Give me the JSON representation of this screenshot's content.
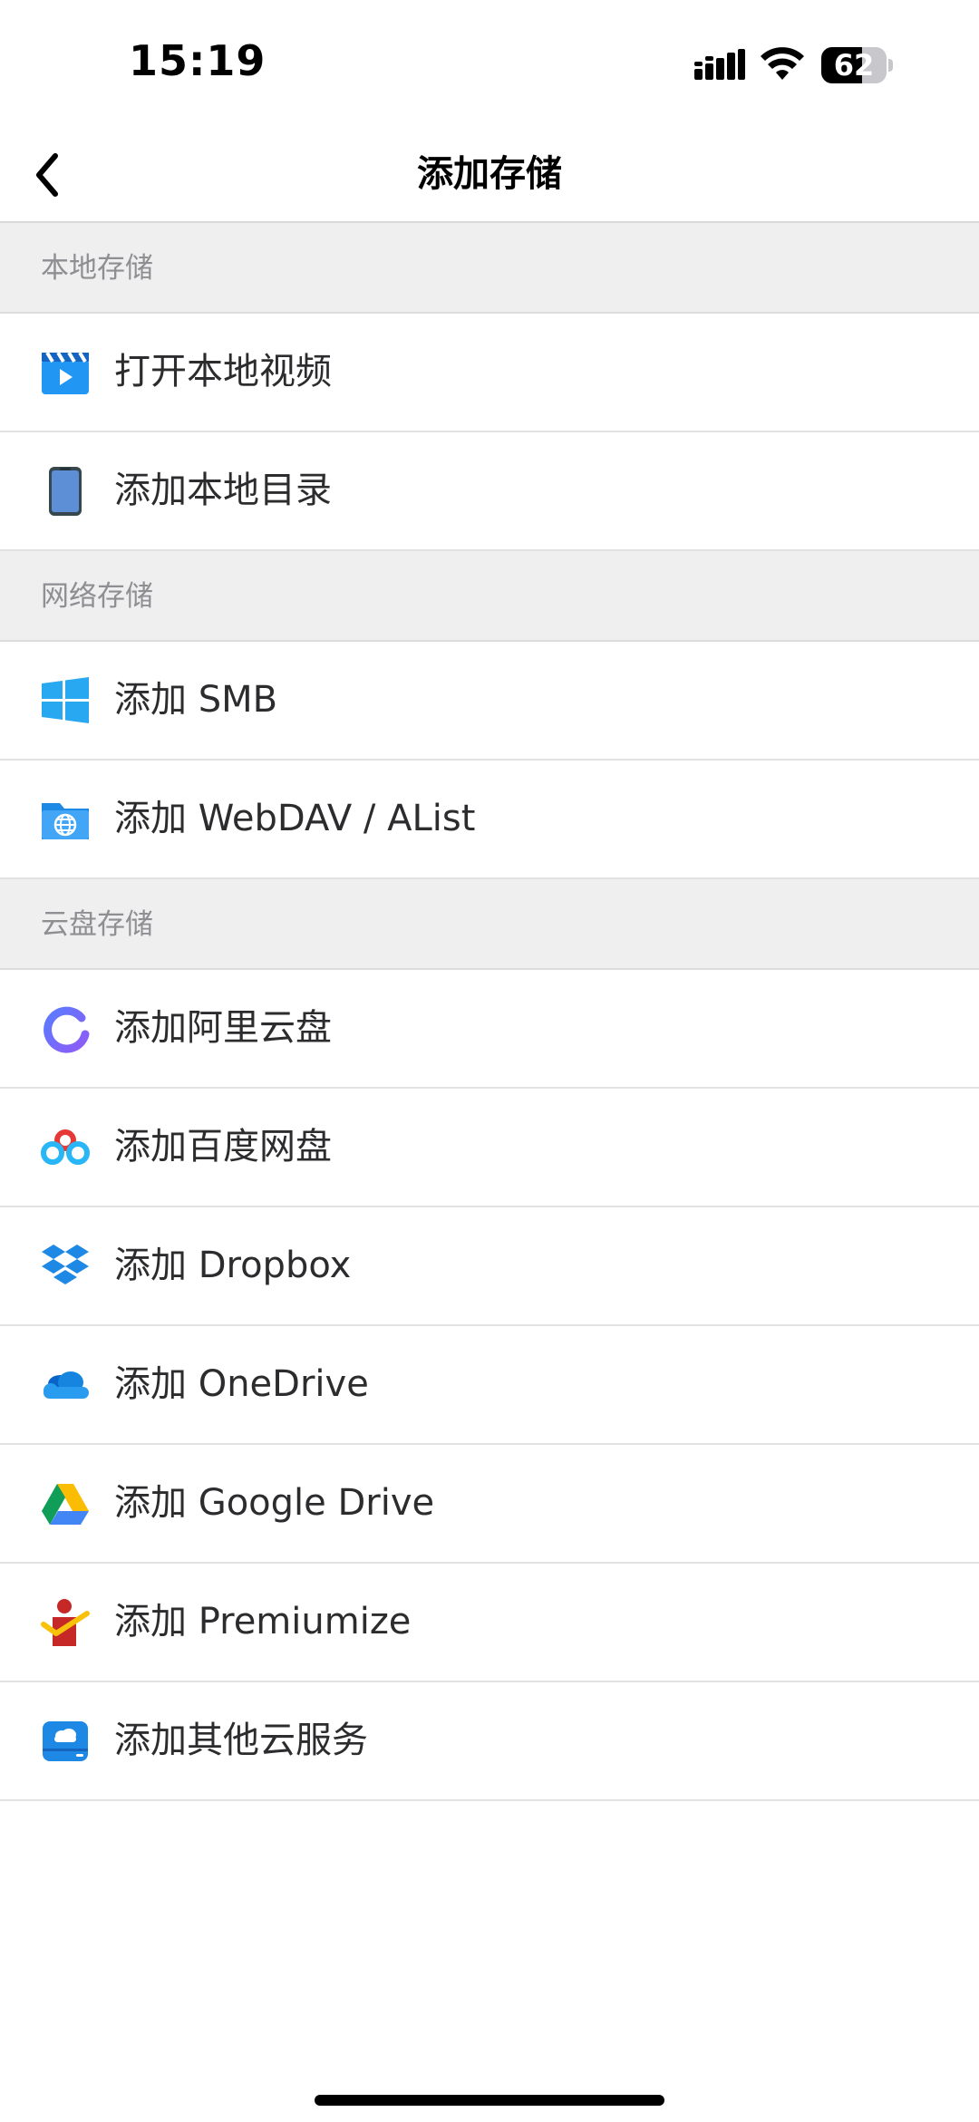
{
  "status_bar": {
    "time": "15:19",
    "battery_level": "62",
    "battery_fraction": 0.62
  },
  "nav": {
    "title": "添加存储",
    "back_icon": "chevron-left-icon"
  },
  "sections": {
    "local": {
      "header": "本地存储",
      "items": [
        {
          "label": "打开本地视频",
          "icon": "clapperboard-icon"
        },
        {
          "label": "添加本地目录",
          "icon": "phone-icon"
        }
      ]
    },
    "network": {
      "header": "网络存储",
      "items": [
        {
          "label": "添加 SMB",
          "icon": "windows-icon"
        },
        {
          "label": "添加 WebDAV / AList",
          "icon": "globe-folder-icon"
        }
      ]
    },
    "cloud": {
      "header": "云盘存储",
      "items": [
        {
          "label": "添加阿里云盘",
          "icon": "aliyun-drive-icon"
        },
        {
          "label": "添加百度网盘",
          "icon": "baidu-netdisk-icon"
        },
        {
          "label": "添加 Dropbox",
          "icon": "dropbox-icon"
        },
        {
          "label": "添加 OneDrive",
          "icon": "onedrive-icon"
        },
        {
          "label": "添加 Google Drive",
          "icon": "google-drive-icon"
        },
        {
          "label": "添加 Premiumize",
          "icon": "premiumize-icon"
        },
        {
          "label": "添加其他云服务",
          "icon": "cloud-drive-icon"
        }
      ]
    }
  },
  "colors": {
    "section_bg": "#efefef",
    "section_text": "#8e8e93",
    "row_text": "#2c2c2e",
    "accent_blue": "#1e88e5"
  }
}
